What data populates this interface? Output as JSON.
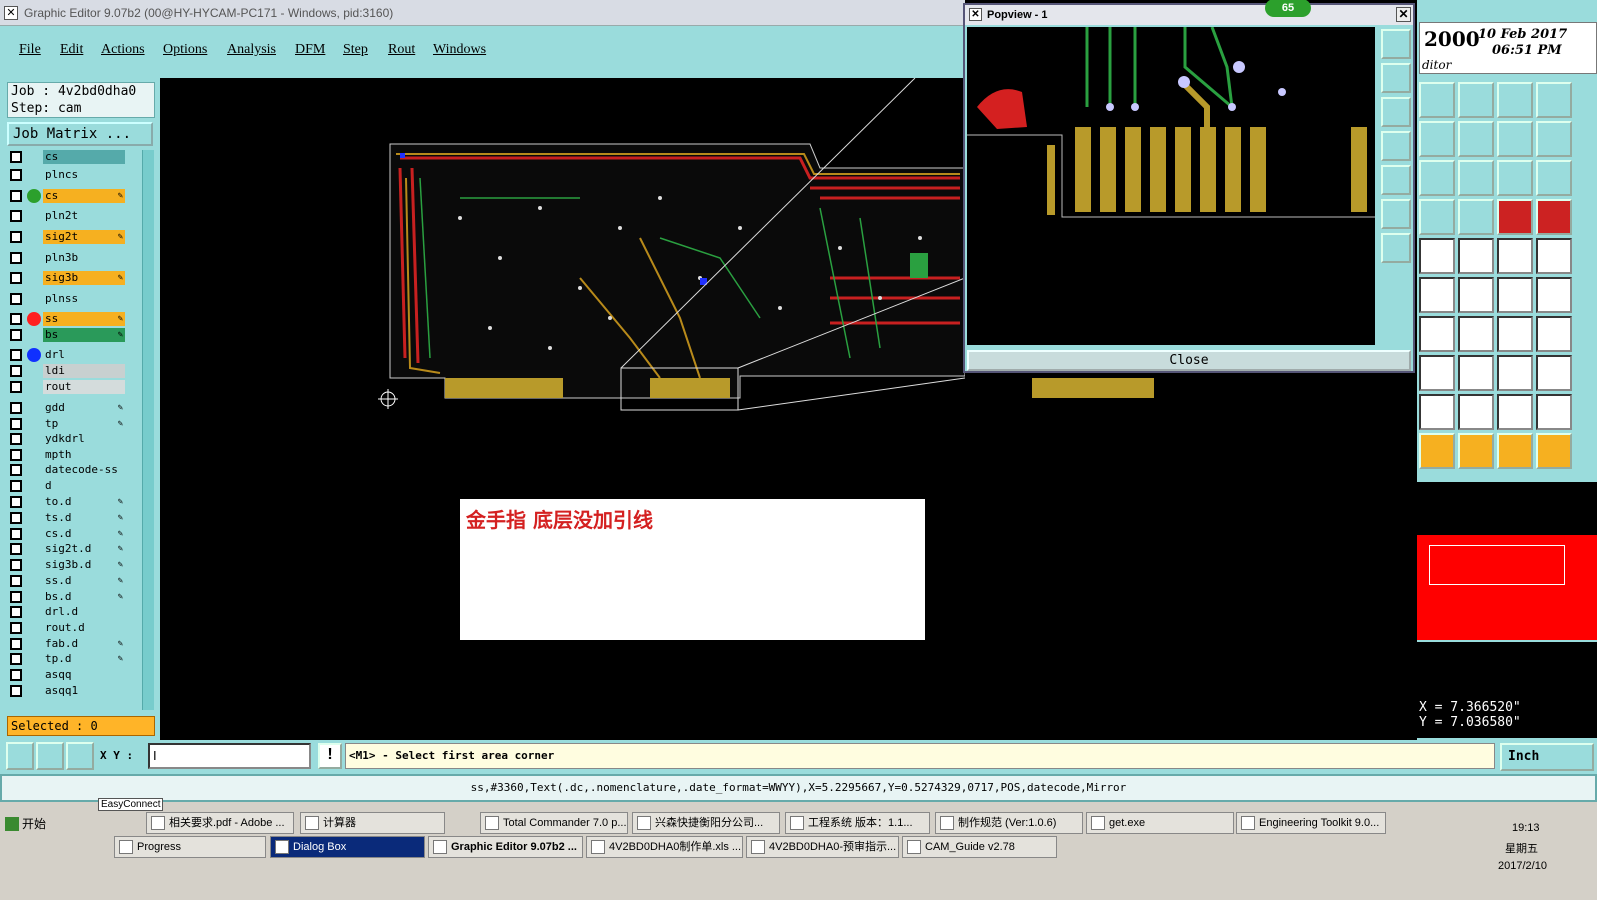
{
  "window": {
    "title": "Graphic Editor 9.07b2 (00@HY-HYCAM-PC171 - Windows, pid:3160)"
  },
  "menu": [
    {
      "label": "File"
    },
    {
      "label": "Edit"
    },
    {
      "label": "Actions"
    },
    {
      "label": "Options"
    },
    {
      "label": "Analysis"
    },
    {
      "label": "DFM"
    },
    {
      "label": "Step"
    },
    {
      "label": "Rout"
    },
    {
      "label": "Windows"
    }
  ],
  "job": {
    "job_line": "Job : 4v2bd0dha0",
    "step_line": "Step: cam",
    "matrix_button": "Job Matrix ..."
  },
  "layers": [
    {
      "name": "cs",
      "color": "#5aa",
      "dot": ""
    },
    {
      "name": "plncs",
      "color": "#9adcdc",
      "dot": ""
    },
    {
      "name": "cs",
      "color": "#f6b020",
      "dot": "#2ca02c",
      "pen": "✎"
    },
    {
      "name": "pln2t",
      "color": "#9adcdc",
      "dot": ""
    },
    {
      "name": "sig2t",
      "color": "#f6b020",
      "dot": "",
      "pen": "✎"
    },
    {
      "name": "pln3b",
      "color": "#9adcdc",
      "dot": ""
    },
    {
      "name": "sig3b",
      "color": "#f6b020",
      "dot": "",
      "pen": "✎"
    },
    {
      "name": "plnss",
      "color": "#9adcdc",
      "dot": ""
    },
    {
      "name": "ss",
      "color": "#f6b020",
      "dot": "#ff2020",
      "pen": "✎"
    },
    {
      "name": "bs",
      "color": "#2a9a5a",
      "dot": "",
      "pen": "✎"
    },
    {
      "name": "drl",
      "color": "#9adcdc",
      "dot": "#1030ff"
    },
    {
      "name": "ldi",
      "color": "#c8d0d0",
      "dot": ""
    },
    {
      "name": "rout",
      "color": "#d4dcdc",
      "dot": ""
    },
    {
      "name": "gdd",
      "color": "#9adcdc",
      "dot": "",
      "pen": "✎"
    },
    {
      "name": "tp",
      "color": "#9adcdc",
      "dot": "",
      "pen": "✎"
    },
    {
      "name": "ydkdrl",
      "color": "#9adcdc",
      "dot": ""
    },
    {
      "name": "mpth",
      "color": "#9adcdc",
      "dot": ""
    },
    {
      "name": "datecode-ss",
      "color": "#9adcdc",
      "dot": ""
    },
    {
      "name": "d",
      "color": "#9adcdc",
      "dot": ""
    },
    {
      "name": "to.d",
      "color": "#9adcdc",
      "dot": "",
      "pen": "✎"
    },
    {
      "name": "ts.d",
      "color": "#9adcdc",
      "dot": "",
      "pen": "✎"
    },
    {
      "name": "cs.d",
      "color": "#9adcdc",
      "dot": "",
      "pen": "✎"
    },
    {
      "name": "sig2t.d",
      "color": "#9adcdc",
      "dot": "",
      "pen": "✎"
    },
    {
      "name": "sig3b.d",
      "color": "#9adcdc",
      "dot": "",
      "pen": "✎"
    },
    {
      "name": "ss.d",
      "color": "#9adcdc",
      "dot": "",
      "pen": "✎"
    },
    {
      "name": "bs.d",
      "color": "#9adcdc",
      "dot": "",
      "pen": "✎"
    },
    {
      "name": "drl.d",
      "color": "#9adcdc",
      "dot": ""
    },
    {
      "name": "rout.d",
      "color": "#9adcdc",
      "dot": ""
    },
    {
      "name": "fab.d",
      "color": "#9adcdc",
      "dot": "",
      "pen": "✎"
    },
    {
      "name": "tp.d",
      "color": "#9adcdc",
      "dot": "",
      "pen": "✎"
    },
    {
      "name": "asqq",
      "color": "#9adcdc",
      "dot": ""
    },
    {
      "name": "asqq1",
      "color": "#9adcdc",
      "dot": ""
    }
  ],
  "selected": "Selected : 0",
  "popview": {
    "title": "Popview - 1",
    "close_label": "Close",
    "badge": "65"
  },
  "right": {
    "year": "2000",
    "date": "10 Feb 2017",
    "time": "06:51 PM",
    "editor": "ditor",
    "x_coord": "X = 7.366520\"",
    "y_coord": "Y = 7.036580\"",
    "units": "Inch"
  },
  "note": {
    "text": "金手指 底层没加引线"
  },
  "command": {
    "xy_label": "X Y :",
    "xy_value": "I",
    "prompt": "<M1> - Select first area corner"
  },
  "status": "ss,#3360,Text(.dc,.nomenclature,.date_format=WWYY),X=5.2295667,Y=0.5274329,0717,POS,datecode,Mirror",
  "taskbar": {
    "start": "开始",
    "easyconnect": "EasyConnect",
    "row1": [
      "相关要求.pdf - Adobe ...",
      "计算器",
      "Total Commander 7.0 p...",
      "兴森快捷衡阳分公司...",
      "工程系统  版本：1.1...",
      "制作规范 (Ver:1.0.6)",
      "get.exe",
      "Engineering Toolkit 9.0..."
    ],
    "row2": [
      "Progress",
      "Dialog Box",
      "Graphic Editor 9.07b2 ...",
      "4V2BD0DHA0制作单.xls ...",
      "4V2BD0DHA0-预审指示...",
      "CAM_Guide v2.78"
    ],
    "clock": "19:13",
    "weekday": "星期五",
    "date": "2017/2/10"
  }
}
